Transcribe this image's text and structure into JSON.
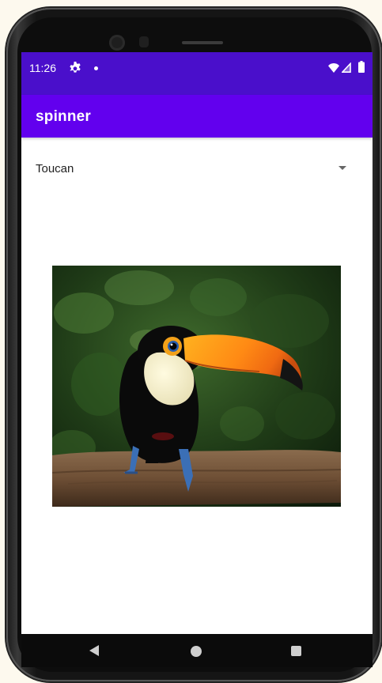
{
  "status_bar": {
    "time": "11:26",
    "icons": [
      "gear-icon",
      "notification-dot",
      "wifi-icon",
      "signal-icon",
      "battery-icon"
    ]
  },
  "app_bar": {
    "title": "spinner"
  },
  "spinner": {
    "selected": "Toucan"
  },
  "image": {
    "subject": "toucan-photo"
  },
  "nav_bar": {
    "icons": [
      "back-icon",
      "home-icon",
      "recents-icon"
    ]
  },
  "colors": {
    "status_bar": "#4a0fcb",
    "app_bar": "#6200ee",
    "background": "#ffffff"
  }
}
